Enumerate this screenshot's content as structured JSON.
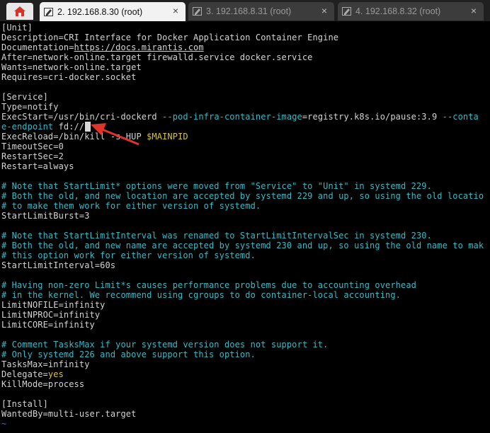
{
  "tabs": [
    {
      "label": "2. 192.168.8.30 (root)",
      "active": true,
      "close": "×"
    },
    {
      "label": "3. 192.168.8.31 (root)",
      "active": false,
      "close": "×"
    },
    {
      "label": "4. 192.168.8.32 (root)",
      "active": false,
      "close": "×"
    }
  ],
  "colors": {
    "comment": "#3fb8c4",
    "flag": "#39b9c6",
    "yellow": "#d6c24a",
    "arrow": "#e0342a",
    "tilde": "#3a6fd0"
  },
  "terminal": {
    "l1": "[Unit]",
    "l2": "Description=CRI Interface for Docker Application Container Engine",
    "l3a": "Documentation=",
    "l3b": "https://docs.mirantis.com",
    "l4": "After=network-online.target firewalld.service docker.service",
    "l5": "Wants=network-online.target",
    "l6": "Requires=cri-docker.socket",
    "l8": "[Service]",
    "l9": "Type=notify",
    "l10a": "ExecStart=/usr/bin/cri-dockerd ",
    "l10b": "--pod-infra-container-image",
    "l10c": "=registry.k8s.io/pause:3.9 ",
    "l10d": "--conta",
    "l11a": "e-endpoint",
    "l11b": " fd://",
    "l12a": "ExecReload=/bin/kill -s HUP ",
    "l12b": "$MAINPID",
    "l13": "TimeoutSec=0",
    "l14": "RestartSec=2",
    "l15": "Restart=always",
    "l17": "# Note that StartLimit* options were moved from \"Service\" to \"Unit\" in systemd 229.",
    "l18": "# Both the old, and new location are accepted by systemd 229 and up, so using the old locatio",
    "l19": "# to make them work for either version of systemd.",
    "l20": "StartLimitBurst=3",
    "l22": "# Note that StartLimitInterval was renamed to StartLimitIntervalSec in systemd 230.",
    "l23": "# Both the old, and new name are accepted by systemd 230 and up, so using the old name to mak",
    "l24": "# this option work for either version of systemd.",
    "l25": "StartLimitInterval=60s",
    "l27": "# Having non-zero Limit*s causes performance problems due to accounting overhead",
    "l28": "# in the kernel. We recommend using cgroups to do container-local accounting.",
    "l29": "LimitNOFILE=infinity",
    "l30": "LimitNPROC=infinity",
    "l31": "LimitCORE=infinity",
    "l33": "# Comment TasksMax if your systemd version does not support it.",
    "l34": "# Only systemd 226 and above support this option.",
    "l35": "TasksMax=infinity",
    "l36a": "Delegate=",
    "l36b": "yes",
    "l37": "KillMode=process",
    "l39": "[Install]",
    "l40": "WantedBy=multi-user.target",
    "l41": "~"
  }
}
